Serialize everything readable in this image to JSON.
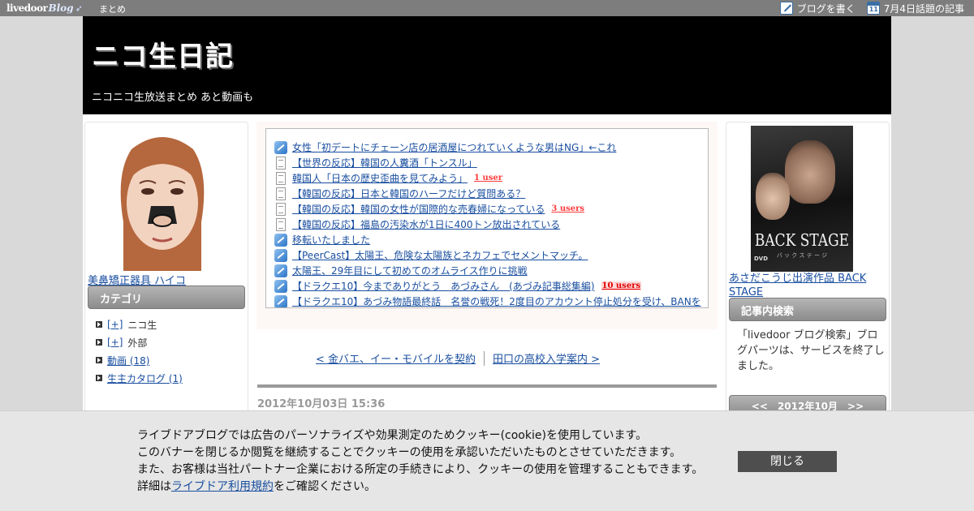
{
  "topbar": {
    "logo_text": "livedoor",
    "logo_blog": "Blog",
    "matome": "まとめ",
    "write_blog": "ブログを書く",
    "topic_articles": "7月4日話題の記事",
    "calendar_day": "11"
  },
  "header": {
    "title": "ニコ生日記",
    "description": "ニコニコ生放送まとめ あと動画も"
  },
  "left": {
    "photo_caption": "美鼻矯正器具 ハイコ",
    "category_heading": "カテゴリ",
    "categories": [
      {
        "toggle": "[+]",
        "label": "ニコ生",
        "link": false
      },
      {
        "toggle": "[+]",
        "label": "外部",
        "link": false
      },
      {
        "toggle": "",
        "label": "動画 (18)",
        "link": true
      },
      {
        "toggle": "",
        "label": "生主カタログ (1)",
        "link": true
      }
    ]
  },
  "links": [
    {
      "icon": "feed-icon",
      "text": "女性「初デートにチェーン店の居酒屋につれていくような男はNG」←これ",
      "users": ""
    },
    {
      "icon": "page-icon",
      "text": "【世界の反応】韓国の人糞酒「トンスル」",
      "users": ""
    },
    {
      "icon": "page-icon",
      "text": "韓国人「日本の歴史歪曲を見てみよう」",
      "users": "1 user"
    },
    {
      "icon": "page-icon",
      "text": "【韓国の反応】日本と韓国のハーフだけど質問ある？",
      "users": ""
    },
    {
      "icon": "page-icon",
      "text": "【韓国の反応】韓国の女性が国際的な売春婦になっている",
      "users": "3 users"
    },
    {
      "icon": "page-icon",
      "text": "【韓国の反応】福島の汚染水が1日に400トン放出されている",
      "users": ""
    },
    {
      "icon": "feed-icon",
      "text": "移転いたしました",
      "users": ""
    },
    {
      "icon": "feed-icon",
      "text": "【PeerCast】太陽王、危険な太陽族とネカフェでセメントマッチ。",
      "users": ""
    },
    {
      "icon": "feed-icon",
      "text": "太陽王、29年目にして初めてのオムライス作りに挑戦",
      "users": ""
    },
    {
      "icon": "feed-icon",
      "text": "【ドラクエ10】今までありがとう　あづみさん　(あづみ記事総集編)",
      "users": "10 users"
    },
    {
      "icon": "feed-icon",
      "text": "【ドラクエ10】あづみ物語最終話　名誉の戦死！2度目のアカウント停止処分を受け、BANを",
      "users": ""
    }
  ],
  "pager": {
    "prev": "< 金バエ、イー・モバイルを契約",
    "next": "田口の高校入学案内 >"
  },
  "post": {
    "date": "2012年10月03日 15:36"
  },
  "right": {
    "dvd_title": "BACK STAGE",
    "dvd_subtitle": "バ ッ ク ス テ ー ジ",
    "dvd_logo": "DVD",
    "dvd_caption": "あさだこうじ出演作品 BACK STAGE",
    "search_heading": "記事内検索",
    "search_notice": "「livedoor ブログ検索」ブログパーツは、サービスを終了しました。",
    "calendar_heading": "<<　2012年10月　>>"
  },
  "cookie": {
    "line1": "ライブドアブログでは広告のパーソナライズや効果測定のためクッキー(cookie)を使用しています。",
    "line2": "このバナーを閉じるか閲覧を継続することでクッキーの使用を承認いただいたものとさせていただきます。",
    "line3": "また、お客様は当社パートナー企業における所定の手続きにより、クッキーの使用を管理することもできます。",
    "line4_prefix": "詳細は",
    "line4_link": "ライブドア利用規約",
    "line4_suffix": "をご確認ください。",
    "close_label": "閉じる"
  }
}
